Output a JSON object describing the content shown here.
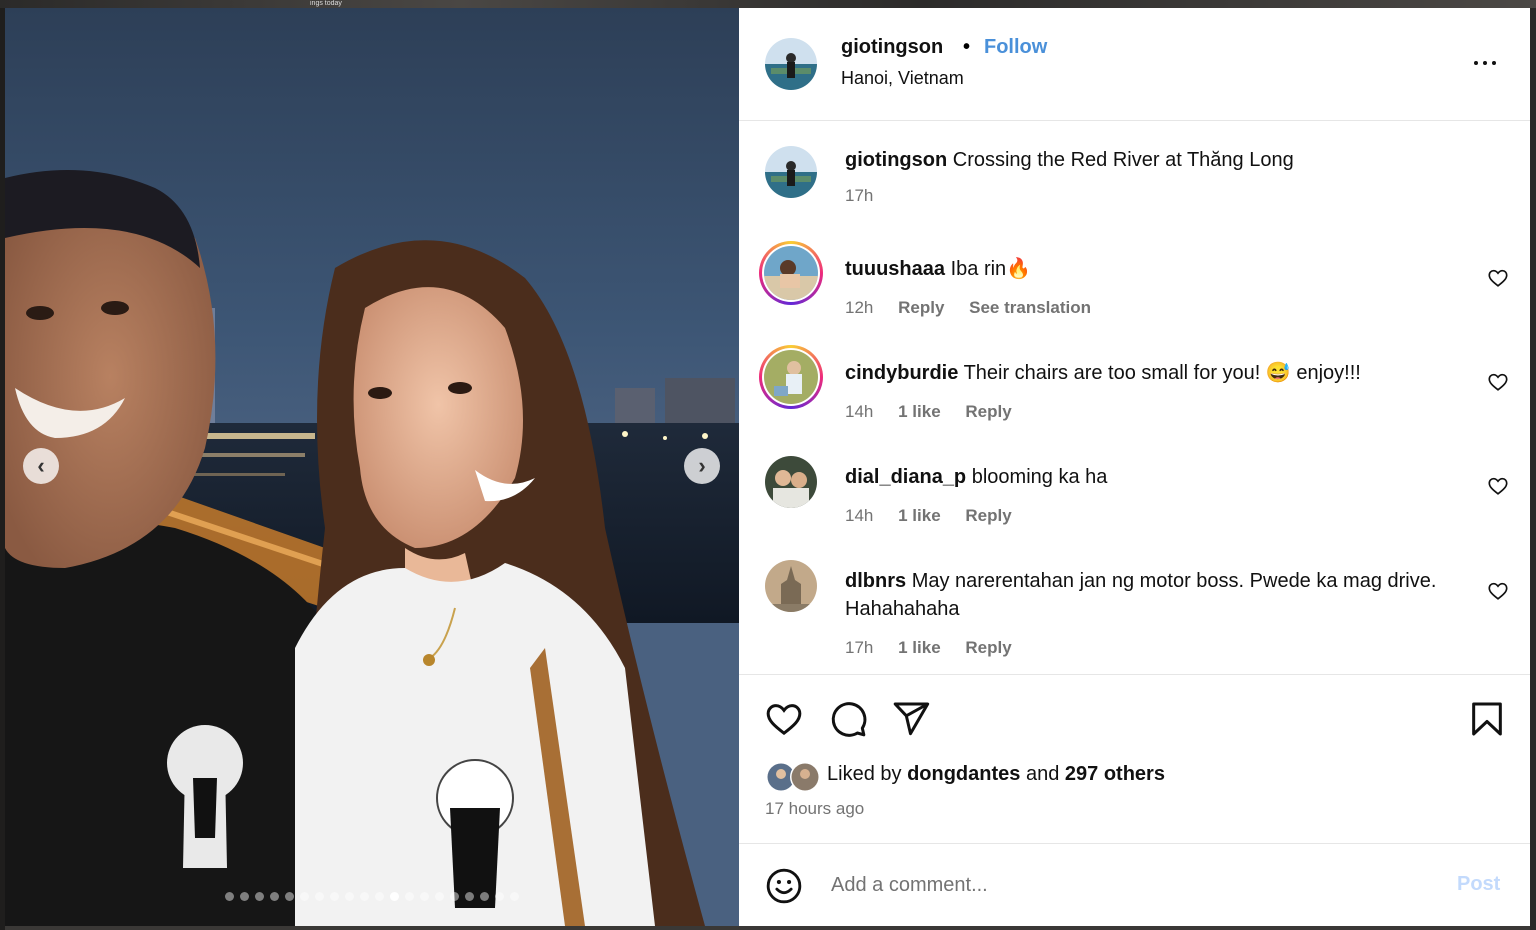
{
  "backdrop": {
    "strip_text": "ings today"
  },
  "photo": {
    "nav_prev": "‹",
    "nav_next": "›",
    "dot_count": 20,
    "active_dot": 11
  },
  "post": {
    "username": "giotingson",
    "separator": "•",
    "follow_label": "Follow",
    "location": "Hanoi, Vietnam",
    "caption": {
      "username": "giotingson",
      "text": "Crossing the Red River at Thăng Long",
      "time": "17h"
    },
    "comments": [
      {
        "username": "tuuushaaa",
        "text": "Iba rin🔥",
        "time": "12h",
        "likes": "",
        "reply": "Reply",
        "extra": "See translation"
      },
      {
        "username": "cindyburdie",
        "text": "Their chairs are too small for you! 😅 enjoy!!!",
        "time": "14h",
        "likes": "1 like",
        "reply": "Reply",
        "extra": ""
      },
      {
        "username": "dial_diana_p",
        "text": "blooming ka ha",
        "time": "14h",
        "likes": "1 like",
        "reply": "Reply",
        "extra": ""
      },
      {
        "username": "dlbnrs",
        "text": "May narerentahan jan ng motor boss. Pwede ka mag drive. Hahahahaha",
        "time": "17h",
        "likes": "1 like",
        "reply": "Reply",
        "extra": ""
      }
    ],
    "likes_prefix": "Liked by",
    "likes_user": "dongdantes",
    "likes_and": "and",
    "likes_others": "297 others",
    "posted_ago": "17 hours ago",
    "comment_placeholder": "Add a comment...",
    "post_label": "Post"
  },
  "colors": {
    "follow": "#4a90d9",
    "muted": "#737373",
    "post_disabled": "#c3dafc"
  }
}
